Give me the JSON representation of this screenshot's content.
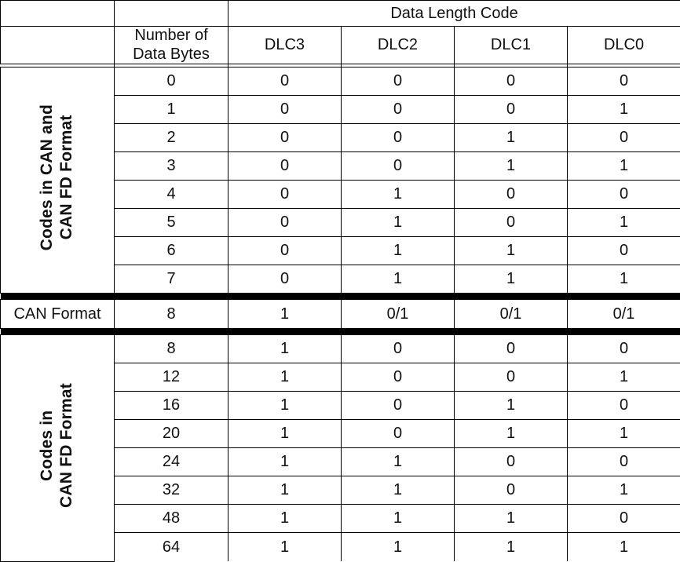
{
  "table": {
    "header": {
      "col_label_blank_top": "",
      "col_label_blank_sub": "",
      "number_of_data_bytes_line1": "Number of",
      "number_of_data_bytes_line2": "Data Bytes",
      "data_length_code": "Data Length Code",
      "dlc_columns": [
        "DLC3",
        "DLC2",
        "DLC1",
        "DLC0"
      ]
    },
    "sections": [
      {
        "id": "can-and-can-fd",
        "label_line1": "Codes in CAN and",
        "label_line2": "CAN FD Format",
        "label_orientation": "vertical",
        "label_bold": true,
        "rows": [
          {
            "data_bytes": "0",
            "dlc3": "0",
            "dlc2": "0",
            "dlc1": "0",
            "dlc0": "0"
          },
          {
            "data_bytes": "1",
            "dlc3": "0",
            "dlc2": "0",
            "dlc1": "0",
            "dlc0": "1"
          },
          {
            "data_bytes": "2",
            "dlc3": "0",
            "dlc2": "0",
            "dlc1": "1",
            "dlc0": "0"
          },
          {
            "data_bytes": "3",
            "dlc3": "0",
            "dlc2": "0",
            "dlc1": "1",
            "dlc0": "1"
          },
          {
            "data_bytes": "4",
            "dlc3": "0",
            "dlc2": "1",
            "dlc1": "0",
            "dlc0": "0"
          },
          {
            "data_bytes": "5",
            "dlc3": "0",
            "dlc2": "1",
            "dlc1": "0",
            "dlc0": "1"
          },
          {
            "data_bytes": "6",
            "dlc3": "0",
            "dlc2": "1",
            "dlc1": "1",
            "dlc0": "0"
          },
          {
            "data_bytes": "7",
            "dlc3": "0",
            "dlc2": "1",
            "dlc1": "1",
            "dlc0": "1"
          }
        ]
      },
      {
        "id": "can-format",
        "label_line1": "CAN Format",
        "label_orientation": "horizontal",
        "label_bold": false,
        "rows": [
          {
            "data_bytes": "8",
            "dlc3": "1",
            "dlc2": "0/1",
            "dlc1": "0/1",
            "dlc0": "0/1"
          }
        ]
      },
      {
        "id": "can-fd",
        "label_line1": "Codes in",
        "label_line2": "CAN FD Format",
        "label_orientation": "vertical",
        "label_bold": true,
        "rows": [
          {
            "data_bytes": "8",
            "dlc3": "1",
            "dlc2": "0",
            "dlc1": "0",
            "dlc0": "0"
          },
          {
            "data_bytes": "12",
            "dlc3": "1",
            "dlc2": "0",
            "dlc1": "0",
            "dlc0": "1"
          },
          {
            "data_bytes": "16",
            "dlc3": "1",
            "dlc2": "0",
            "dlc1": "1",
            "dlc0": "0"
          },
          {
            "data_bytes": "20",
            "dlc3": "1",
            "dlc2": "0",
            "dlc1": "1",
            "dlc0": "1"
          },
          {
            "data_bytes": "24",
            "dlc3": "1",
            "dlc2": "1",
            "dlc1": "0",
            "dlc0": "0"
          },
          {
            "data_bytes": "32",
            "dlc3": "1",
            "dlc2": "1",
            "dlc1": "0",
            "dlc0": "1"
          },
          {
            "data_bytes": "48",
            "dlc3": "1",
            "dlc2": "1",
            "dlc1": "1",
            "dlc0": "0"
          },
          {
            "data_bytes": "64",
            "dlc3": "1",
            "dlc2": "1",
            "dlc1": "1",
            "dlc0": "1"
          }
        ]
      }
    ],
    "colors": {
      "text": "#111111",
      "rule": "#000000",
      "thick_rule": "#000000",
      "background": "#ffffff"
    }
  }
}
